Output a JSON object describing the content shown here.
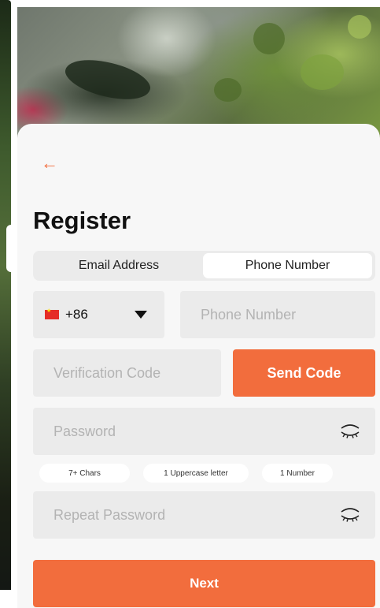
{
  "header": {
    "back_icon": "arrow-left-icon",
    "title": "Register"
  },
  "tabs": [
    {
      "label": "Email Address",
      "selected": false
    },
    {
      "label": "Phone Number",
      "selected": true
    }
  ],
  "form": {
    "country_code": "+86",
    "country_flag": "china-flag-icon",
    "phone_placeholder": "Phone Number",
    "code_placeholder": "Verification Code",
    "send_code_label": "Send Code",
    "password_placeholder": "Password",
    "repeat_password_placeholder": "Repeat Password",
    "eye_icon": "eye-closed-icon"
  },
  "password_hints": [
    "7+ Chars",
    "1 Uppercase letter",
    "1 Number"
  ],
  "actions": {
    "next_label": "Next"
  },
  "colors": {
    "accent": "#f26d3d",
    "field_bg": "#ebebeb",
    "sheet_bg": "#f7f7f7"
  }
}
